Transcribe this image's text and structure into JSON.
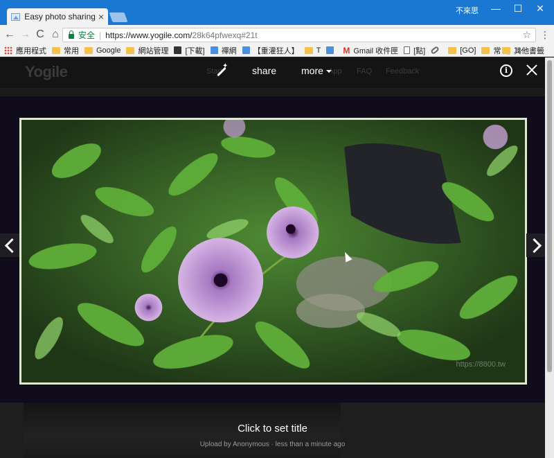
{
  "browser": {
    "tab_title": "Easy photo sharing | Yo",
    "tab_close": "×",
    "user_name": "不來思",
    "window_controls": {
      "minimize": "—",
      "maximize": "☐",
      "close": "✕"
    },
    "nav": {
      "back": "←",
      "forward": "→",
      "reload": "C",
      "home": "⌂",
      "star": "☆",
      "menu": "⋮"
    },
    "secure_label": "安全",
    "separator": "|",
    "url_host": "https://www.yogile.com/",
    "url_path": "28k64pfwexq#21t",
    "bookmarks": [
      {
        "label": "應用程式",
        "icon": "apps-icon"
      },
      {
        "label": "常用",
        "icon": "folder-icon"
      },
      {
        "label": "Google",
        "icon": "folder-icon"
      },
      {
        "label": "網站管理",
        "icon": "folder-icon"
      },
      {
        "label": "[下載]",
        "icon": "building-icon"
      },
      {
        "label": "禪網",
        "icon": "blogger-icon"
      },
      {
        "label": "【重灌狂人】",
        "icon": "blogger-icon"
      },
      {
        "label": "T",
        "icon": "folder-icon"
      },
      {
        "label": "",
        "icon": "chart-icon"
      },
      {
        "label": "Gmail 收件匣",
        "icon": "gmail-icon"
      },
      {
        "label": "[點]",
        "icon": "page-icon"
      },
      {
        "label": "",
        "icon": "link-icon"
      },
      {
        "label": "[GO]",
        "icon": "folder-icon"
      },
      {
        "label": "常 用",
        "icon": "folder-icon"
      }
    ],
    "bookmarks_more": "»",
    "other_bookmarks": "其他書籤"
  },
  "site": {
    "logo": "Yogile",
    "nav": {
      "start": "Start",
      "app": "App",
      "faq": "FAQ",
      "feedback": "Feedback"
    }
  },
  "lightbox": {
    "share": "share",
    "more": "more",
    "info": "i",
    "watermark": "https://8800.tw",
    "title": "Click to set title",
    "meta": "Upload by Anonymous · less than a minute ago"
  },
  "colors": {
    "titlebar": "#1a78d2",
    "secure": "#0b8043",
    "stage": "#100c1c",
    "page": "#1c1c1c"
  }
}
